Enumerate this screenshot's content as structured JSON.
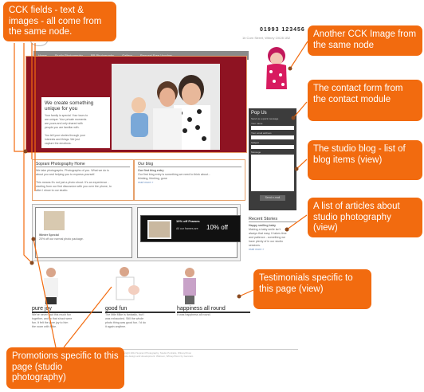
{
  "site": {
    "phone": "01993 123456",
    "address": "1b Corn Street, Witney OX28 1BZ",
    "nav": [
      "Home",
      "Studio Photography",
      "PR Photography",
      "Gallery",
      "Request Free Voucher"
    ],
    "hero": {
      "heading": "We create something unique for you",
      "body1": "Your family is special. Your tours to",
      "body2": "are unique. Your private moments",
      "body3": "are yours and only shared with",
      "body4": "people you are familiar with.",
      "body5": "You tell your stories through your",
      "body6": "interests and things. We just",
      "body7": "capture the emotions."
    },
    "about": {
      "title": "Soprani Photography Home",
      "line1": "We take photographs. Photographs of you. What we do is",
      "line2": "about you and helping you to express yourself.",
      "line3": "This means it's not just a photo shoot. It's an experience -",
      "line4": "starting from our first discussion with you over the phone, to",
      "line5": "after I show to our studio."
    },
    "blog": {
      "title": "Our blog",
      "item_title": "Our first blog entry",
      "item_text1": "Our first blog entry is something we need to think about...",
      "item_text2": "thinking, thinking, gone",
      "read_more": "read more »"
    },
    "contact": {
      "title": "Pop Us",
      "subtitle": "Send us a quick message",
      "name_label": "Your name",
      "email_label": "Your email address",
      "subject_label": "Subject",
      "message_label": "Message",
      "send_label": "Send e-mail"
    },
    "recent": {
      "title": "Recent Stories",
      "item_title": "Happy smiling baby",
      "text1": "Making a baby smile isn't",
      "text2": "always that easy. It takes time",
      "text3": "and patience - something we",
      "text4": "have plenty of in our studio",
      "text5": "sessions.",
      "read_more": "read more »"
    },
    "promos": [
      {
        "title": "Winter Special",
        "text": "20% off our normal photo package."
      },
      {
        "title": "10% off Frames",
        "sub": "All our frames are",
        "big": "10% off"
      }
    ],
    "testimonials": [
      {
        "name": "pure joy",
        "text1": "We've never had this much fun",
        "text2": "together, and in that shoot were",
        "text3": "fun. It felt the pure joy to him",
        "text4": "the room with Mike."
      },
      {
        "name": "good fun",
        "text1": "The little Mike is fantastic, but I",
        "text2": "was exhausted. Still the whole",
        "text3": "photo thing was good fun. I'd do",
        "text4": "it again anytime."
      },
      {
        "name": "happiness all round",
        "text1": "It was happiness all round."
      }
    ],
    "footer1": "Copyright 2012 Soprani Photography, Studio Portraits, Witney/Oxon",
    "footer2": "Website design and development: Webson, Witney/Oxon by Gennaro"
  },
  "callouts": {
    "cck": "CCK fields - text & images - all come from the same node.",
    "another_cck": "Another CCK Image from the same node",
    "contact": "The contact form from the contact module",
    "blog": "The studio blog - list of blog items (view)",
    "articles": "A list of articles about studio photography (view)",
    "testimonials": "Testimonials specific to this page (view)",
    "promotions": "Promotions specific to this page (studio photography)"
  },
  "colors": {
    "callout": "#f26b0f",
    "hero": "#8e1322",
    "sidebar": "#3c3c3c"
  }
}
